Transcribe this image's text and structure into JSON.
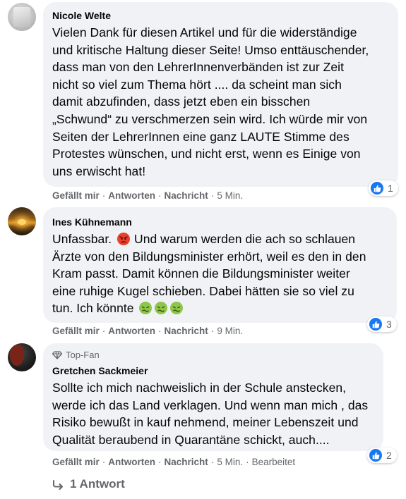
{
  "colors": {
    "bubble": "#f0f2f5",
    "secondary_text": "#65676b",
    "like_blue": "#1877f2"
  },
  "comments": [
    {
      "author": "Nicole Welte",
      "badge": "",
      "text": "Vielen Dank für diesen Artikel und für die widerständige\nund kritische Haltung dieser Seite! Umso enttäuschender,\ndass man von den LehrerInnenverbänden ist zur Zeit\nnicht so viel zum Thema hört .... da scheint man sich\ndamit abzufinden, dass jetzt eben ein bisschen\n„Schwund“ zu verschmerzen sein wird. Ich würde mir von\nSeiten der LehrerInnen eine ganz LAUTE Stimme des\nProtestes wünschen, und nicht erst, wenn es Einige von\nuns erwischt hat!",
      "like": "Gefällt mir",
      "reply": "Antworten",
      "message": "Nachricht",
      "time": "5 Min.",
      "reaction_icon": "like-icon",
      "reaction_count": "1"
    },
    {
      "author": "Ines Kühnemann",
      "badge": "",
      "text_lines": [
        "Unfassbar.",
        "Und warum werden die ach so schlauen",
        "Ärzte von den Bildungsminister erhört, weil es den in den",
        "Kram passt. Damit können die Bildungsminister weiter",
        "eine ruhige Kugel schieben. Dabei hätten sie so viel zu",
        "tun. Ich könnte"
      ],
      "emojis": [
        "angry-face-icon",
        "nauseated-face-icon",
        "nauseated-face-icon",
        "nauseated-face-icon"
      ],
      "like": "Gefällt mir",
      "reply": "Antworten",
      "message": "Nachricht",
      "time": "9 Min.",
      "reaction_icon": "like-icon",
      "reaction_count": "3"
    },
    {
      "author": "Gretchen Sackmeier",
      "badge": "Top-Fan",
      "text": "Sollte ich mich nachweislich in der Schule anstecken,\nwerde ich das Land verklagen. Und wenn man mich , das\nRisiko bewußt in kauf nehmend, meiner Lebenszeit und\nQualität beraubend in Quarantäne schickt, auch....",
      "like": "Gefällt mir",
      "reply": "Antworten",
      "message": "Nachricht",
      "time": "5 Min.",
      "edited": "Bearbeitet",
      "reaction_icon": "like-icon",
      "reaction_count": "2"
    }
  ],
  "replies_link": "1 Antwort"
}
